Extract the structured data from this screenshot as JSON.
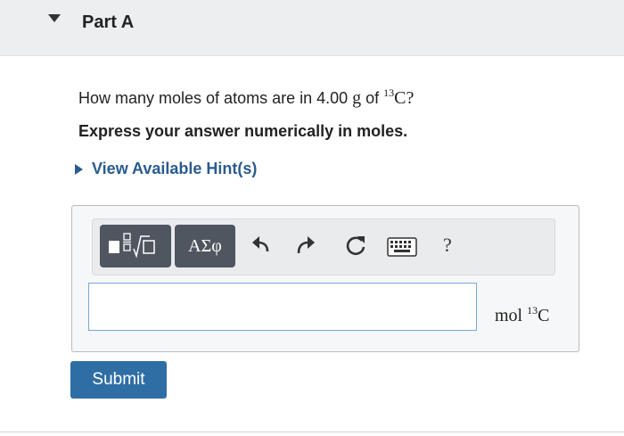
{
  "part": {
    "title": "Part A"
  },
  "question": {
    "text_before": "How many moles of atoms are in 4.00 ",
    "unit": "g",
    "text_of": " of ",
    "isotope_mass": "13",
    "element": "C",
    "text_end": "?"
  },
  "instruction": "Express your answer numerically in moles.",
  "hint": {
    "label": "View Available Hint(s)"
  },
  "toolbar": {
    "templates_icon": "templates-icon",
    "greek_label": "ΑΣφ",
    "undo_icon": "undo-icon",
    "redo_icon": "redo-icon",
    "reset_icon": "reset-icon",
    "keyboard_icon": "keyboard-icon",
    "help_label": "?"
  },
  "answer": {
    "value": "",
    "unit_prefix": "mol ",
    "unit_mass": "13",
    "unit_element": "C"
  },
  "submit": {
    "label": "Submit"
  },
  "colors": {
    "link": "#2a5b8f",
    "submit": "#2f6ea5",
    "toolbar_button": "#4f5660",
    "input_border": "#7aa7d6"
  }
}
